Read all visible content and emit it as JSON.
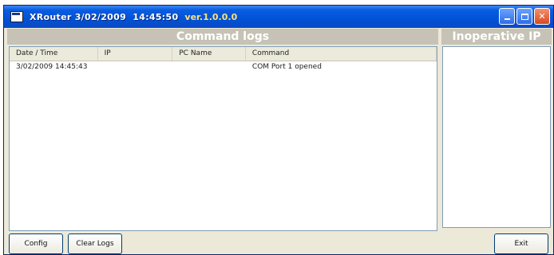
{
  "window": {
    "title": "XRouter 3/02/2009  14:45:50",
    "version": "ver.1.0.0.0"
  },
  "panels": {
    "command_logs_title": "Command logs",
    "inoperative_ip_title": "Inoperative IP"
  },
  "table": {
    "columns": [
      "Date / Time",
      "IP",
      "PC Name",
      "Command"
    ],
    "rows": [
      [
        "3/02/2009 14:45:43",
        "",
        "",
        "COM Port 1 opened"
      ]
    ]
  },
  "buttons": {
    "config": "Config",
    "clear_logs": "Clear Logs",
    "exit": "Exit"
  },
  "icons": {
    "app": "app-icon",
    "minimize": "minimize-icon",
    "maximize": "maximize-icon",
    "close": "close-icon"
  },
  "colors": {
    "titlebar": "#0052d6",
    "version_text": "#ffe27a",
    "panel_header": "#c6c3b6"
  }
}
